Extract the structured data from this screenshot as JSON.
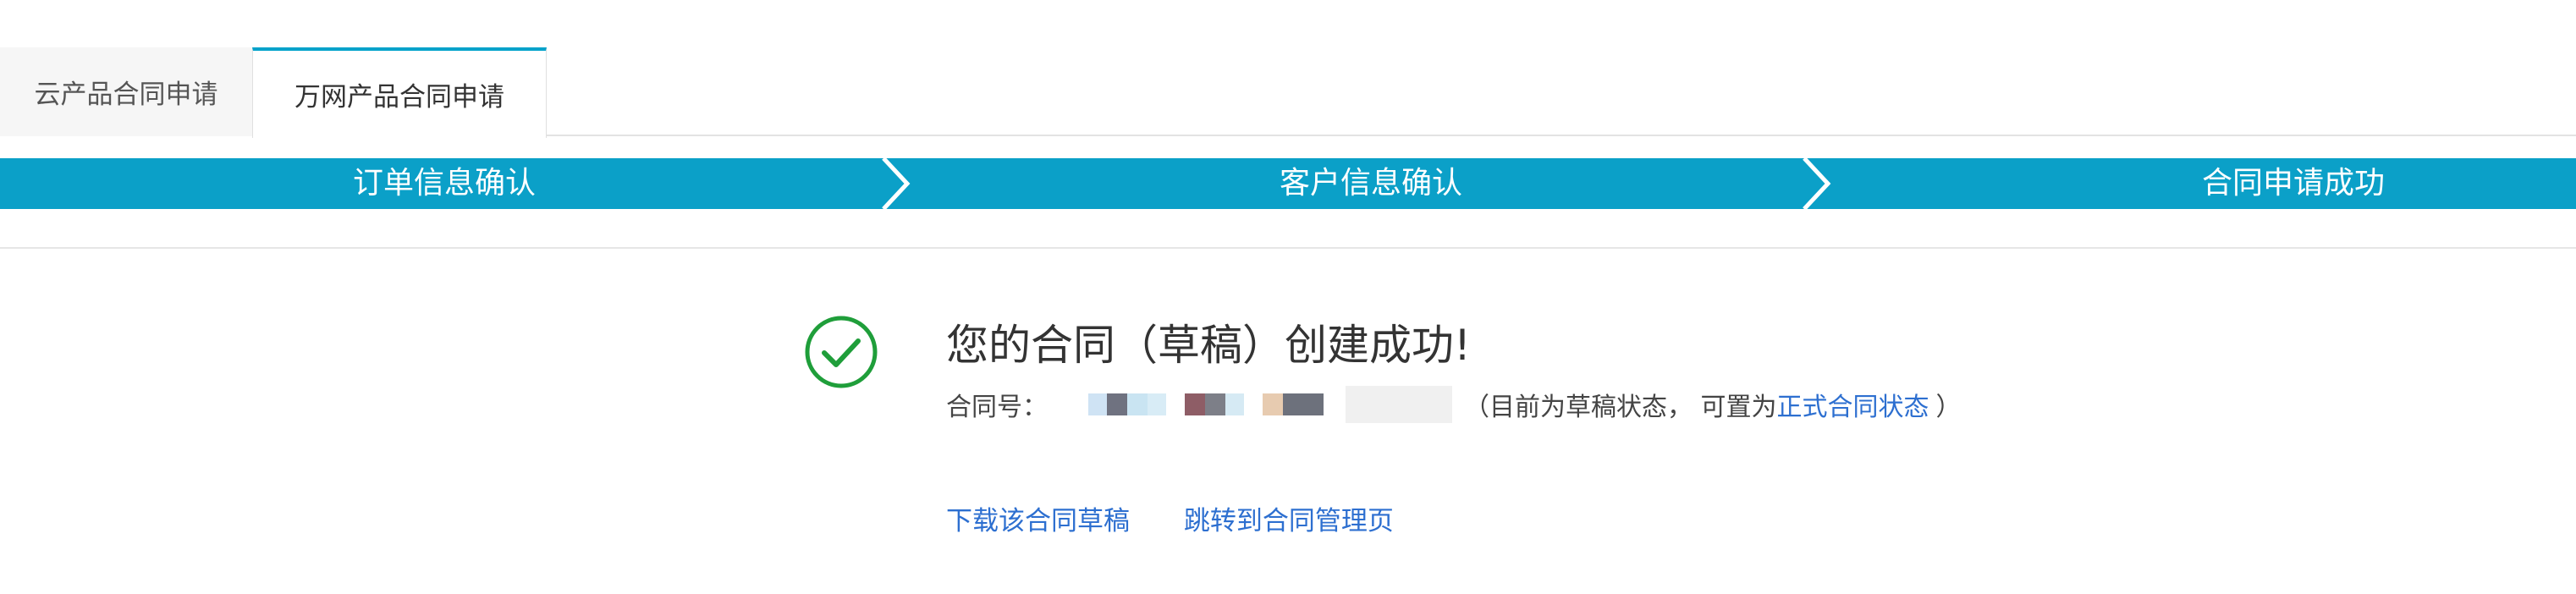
{
  "tabs": [
    {
      "label": "云产品合同申请",
      "active": false
    },
    {
      "label": "万网产品合同申请",
      "active": true
    }
  ],
  "steps": [
    {
      "label": "订单信息确认"
    },
    {
      "label": "客户信息确认"
    },
    {
      "label": "合同申请成功"
    }
  ],
  "result": {
    "icon": "check-circle-icon",
    "title": "您的合同（草稿）创建成功!",
    "contract_label": "合同号：",
    "status_prefix": "（目前为草稿状态， 可置为",
    "status_link": "正式合同状态",
    "status_suffix": "）"
  },
  "actions": {
    "download": "下载该合同草稿",
    "goto_manage": "跳转到合同管理页"
  },
  "colors": {
    "accent": "#0ba0c8",
    "success": "#1f9e3a",
    "link": "#2d6fd0"
  }
}
